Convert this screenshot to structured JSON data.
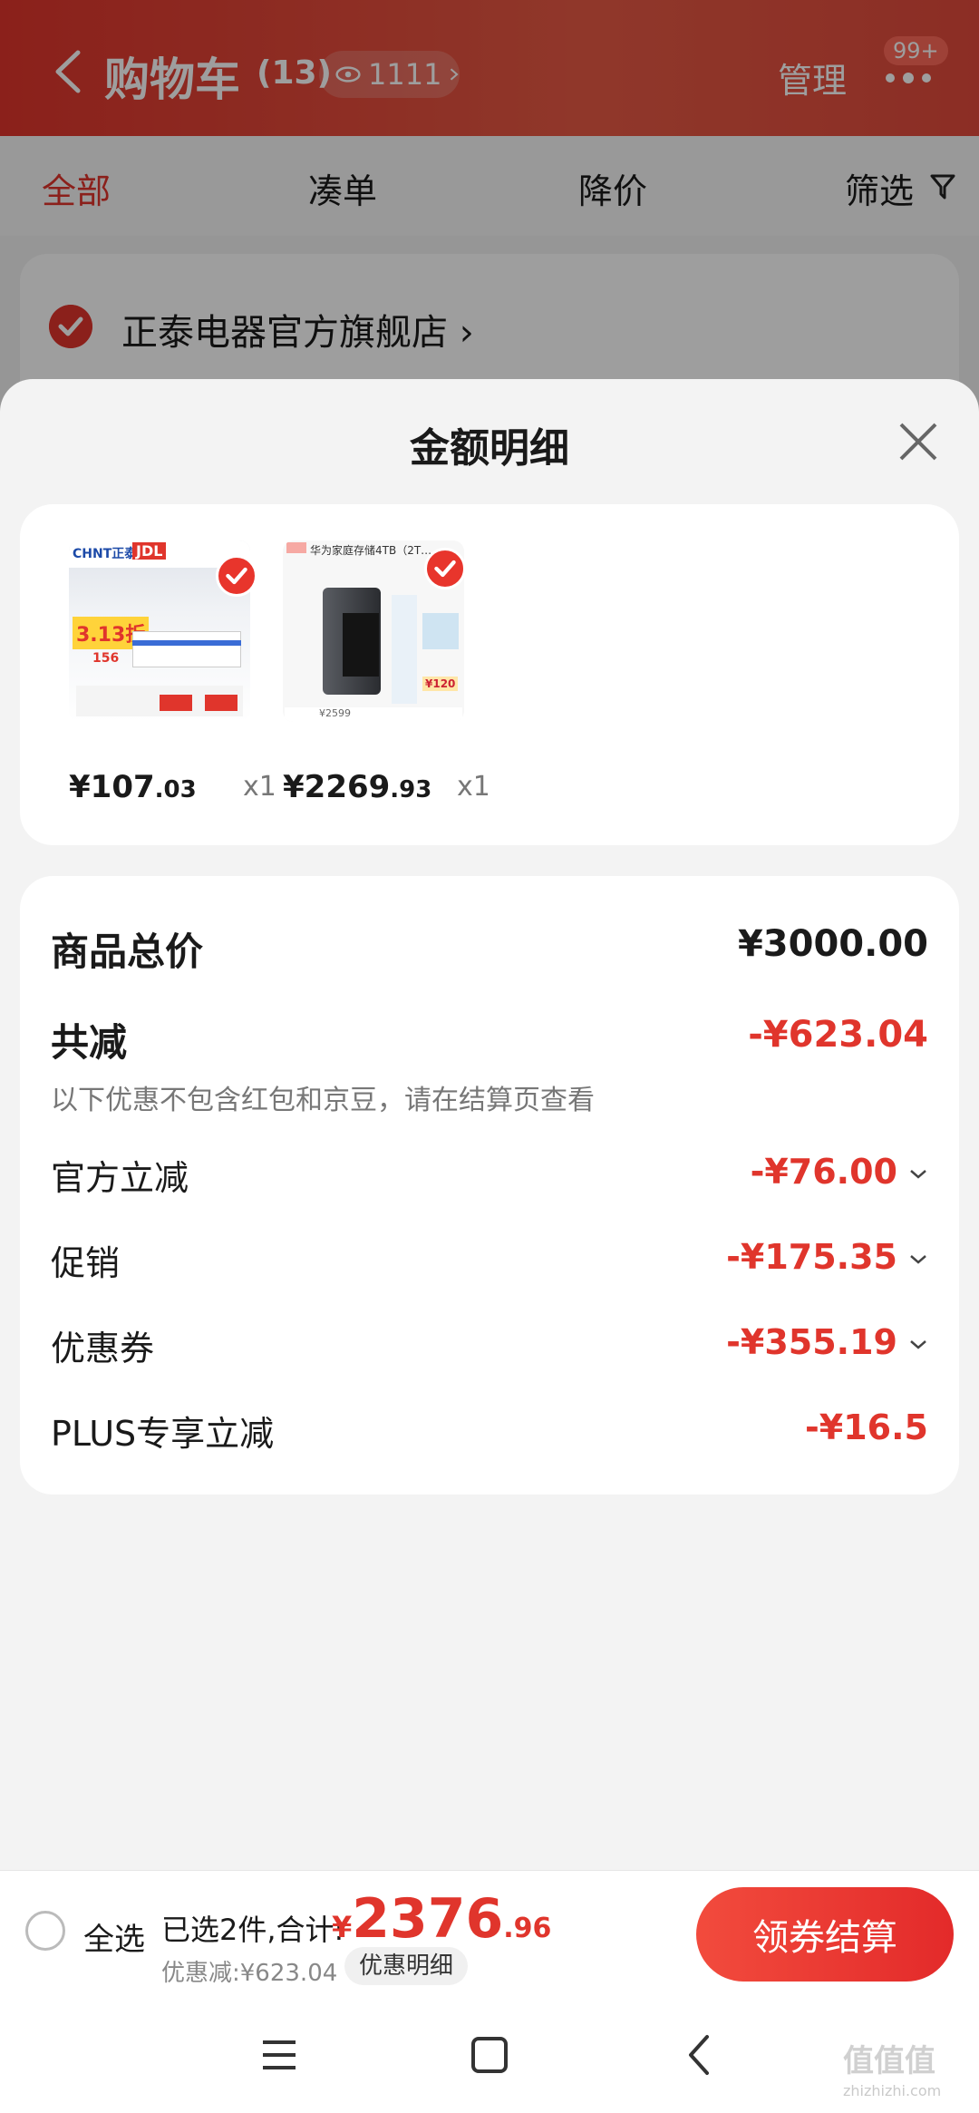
{
  "header": {
    "title": "购物车",
    "count": "(13)",
    "views": "1111",
    "manage": "管理",
    "badge": "99+"
  },
  "tabs": [
    {
      "label": "全部",
      "active": true
    },
    {
      "label": "凑单",
      "active": false
    },
    {
      "label": "降价",
      "active": false
    },
    {
      "label": "筛选",
      "active": false
    }
  ],
  "store": {
    "name": "正泰电器官方旗舰店"
  },
  "sheet": {
    "title": "金额明细",
    "products": [
      {
        "price_int": "¥107",
        "price_dec": ".03",
        "qty": "x1",
        "selected": true,
        "thumb_text": [
          "CHNT正泰",
          "JDL",
          "3.13折",
          "156"
        ]
      },
      {
        "price_int": "¥2269",
        "price_dec": ".93",
        "qty": "x1",
        "selected": true,
        "thumb_text": [
          "华为家庭存储4TB（2T…",
          "¥120",
          "¥2599"
        ]
      }
    ],
    "summary": {
      "total_label": "商品总价",
      "total_value": "¥3000.00",
      "reduce_label": "共减",
      "reduce_value": "-¥623.04",
      "note": "以下优惠不包含红包和京豆，请在结算页查看",
      "items": [
        {
          "label": "官方立减",
          "value": "-¥76.00",
          "expandable": true
        },
        {
          "label": "促销",
          "value": "-¥175.35",
          "expandable": true
        },
        {
          "label": "优惠券",
          "value": "-¥355.19",
          "expandable": true
        },
        {
          "label": "PLUS专享立减",
          "value": "-¥16.5",
          "expandable": false
        }
      ]
    }
  },
  "bottom": {
    "select_all": "全选",
    "selected_text": "已选2件,合计:",
    "total_yen": "¥",
    "total_int": "2376",
    "total_dec": ".96",
    "discount": "优惠减:¥623.04",
    "detail_button": "优惠明细",
    "checkout": "领券结算"
  },
  "watermark": {
    "text": "值值值",
    "sub": "zhizhizhi.com"
  },
  "colors": {
    "accent": "#e0352c"
  }
}
